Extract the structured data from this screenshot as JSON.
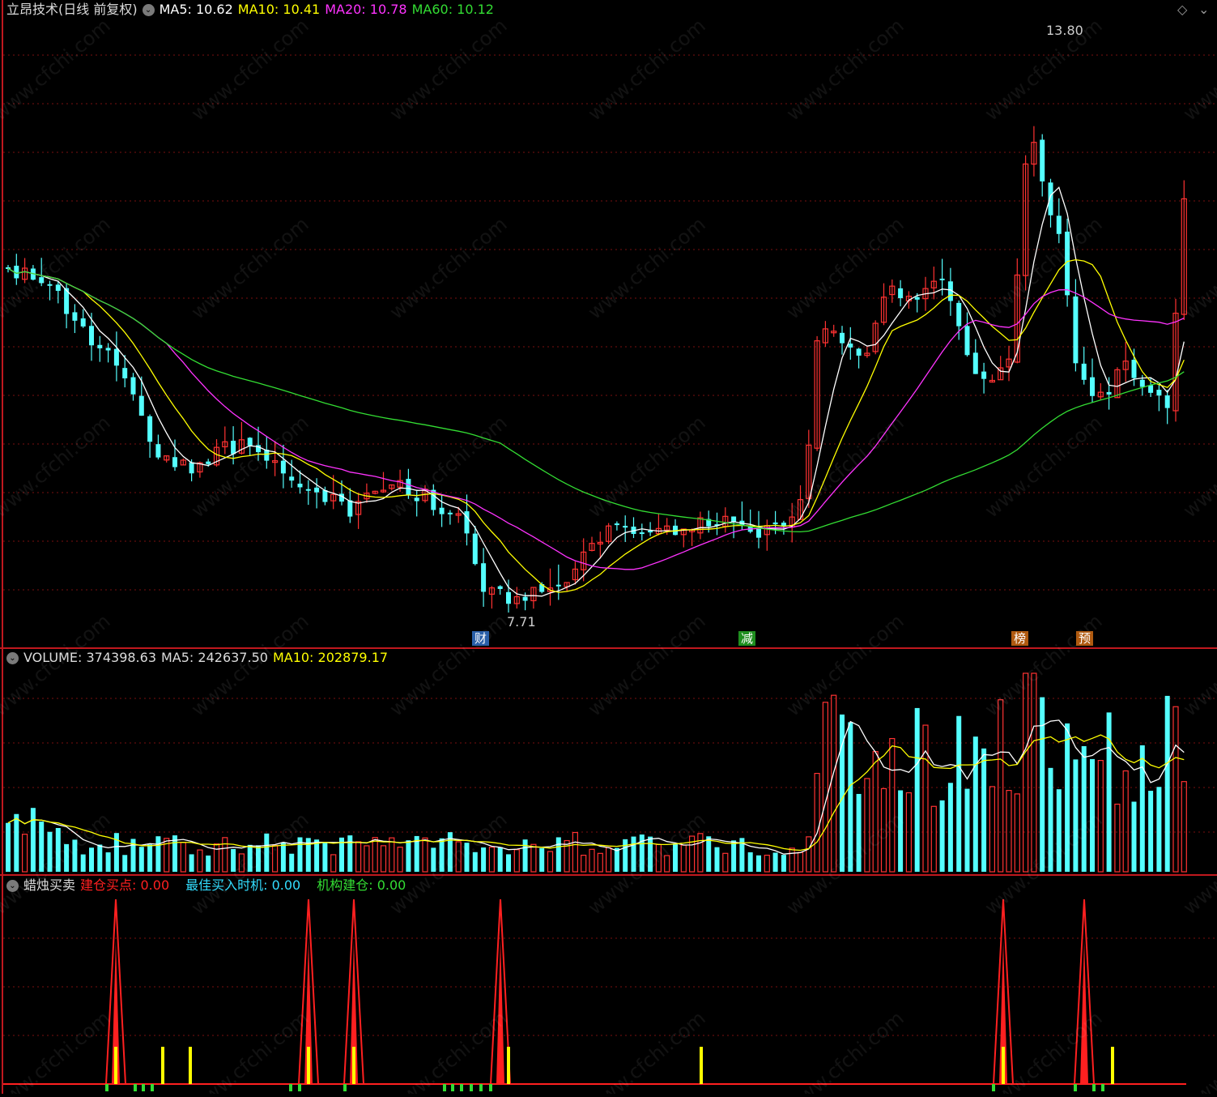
{
  "main": {
    "title": "立昂技术(日线 前复权)",
    "ma": [
      {
        "label": "MA5: 10.62",
        "color": "#ffffff"
      },
      {
        "label": "MA10: 10.41",
        "color": "#ffff00"
      },
      {
        "label": "MA20: 10.78",
        "color": "#ff33ff"
      },
      {
        "label": "MA60: 10.12",
        "color": "#33dd33"
      }
    ],
    "high_label": "13.80",
    "low_label": "7.71",
    "event_tags": [
      {
        "label": "财",
        "bg": "#2a5fa8",
        "color": "#ffffff"
      },
      {
        "label": "减",
        "bg": "#1f8f1f",
        "color": "#ffffff"
      },
      {
        "label": "榜",
        "bg": "#b05a10",
        "color": "#ffffff"
      },
      {
        "label": "预",
        "bg": "#b05a10",
        "color": "#ffffff"
      }
    ],
    "window_icons": [
      "diamond-icon",
      "close-icon"
    ]
  },
  "volume": {
    "title": "VOLUME: 374398.63",
    "ma5": "MA5: 242637.50",
    "ma10": "MA10: 202879.17"
  },
  "indicator": {
    "title": "蜡烛买卖",
    "items": [
      {
        "label": "建仓买点: 0.00",
        "color": "#ff2020"
      },
      {
        "label": "最佳买入时机: 0.00",
        "color": "#33ddff"
      },
      {
        "label": "机构建仓: 0.00",
        "color": "#33dd33"
      }
    ]
  },
  "watermark": "www.cfchi.com",
  "colors": {
    "up": "#ff3232",
    "down": "#54ffff",
    "divider": "#c0181e",
    "grid": "#7a1010"
  }
}
